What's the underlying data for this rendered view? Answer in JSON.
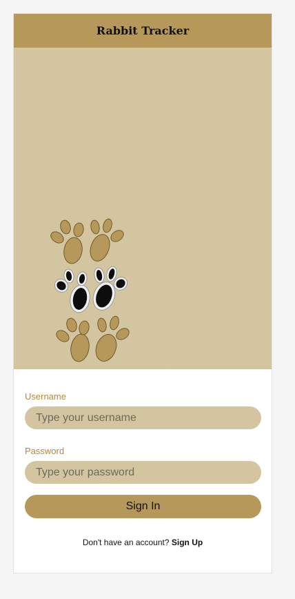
{
  "header": {
    "title": "Rabbit Tracker"
  },
  "hero": {
    "image": "rabbit-paw-prints",
    "icon": "paw-prints-icon"
  },
  "form": {
    "username_label": "Username",
    "username_placeholder": "Type your username",
    "username_value": "",
    "password_label": "Password",
    "password_placeholder": "Type your password",
    "password_value": "",
    "submit_label": "Sign In"
  },
  "footer": {
    "prompt": "Don't have an account?",
    "signup_label": "Sign Up"
  },
  "colors": {
    "brand": "#b5985a",
    "hero_bg": "#d3c5a0",
    "input_bg": "#d3c5a0",
    "label": "#b08a3e"
  }
}
